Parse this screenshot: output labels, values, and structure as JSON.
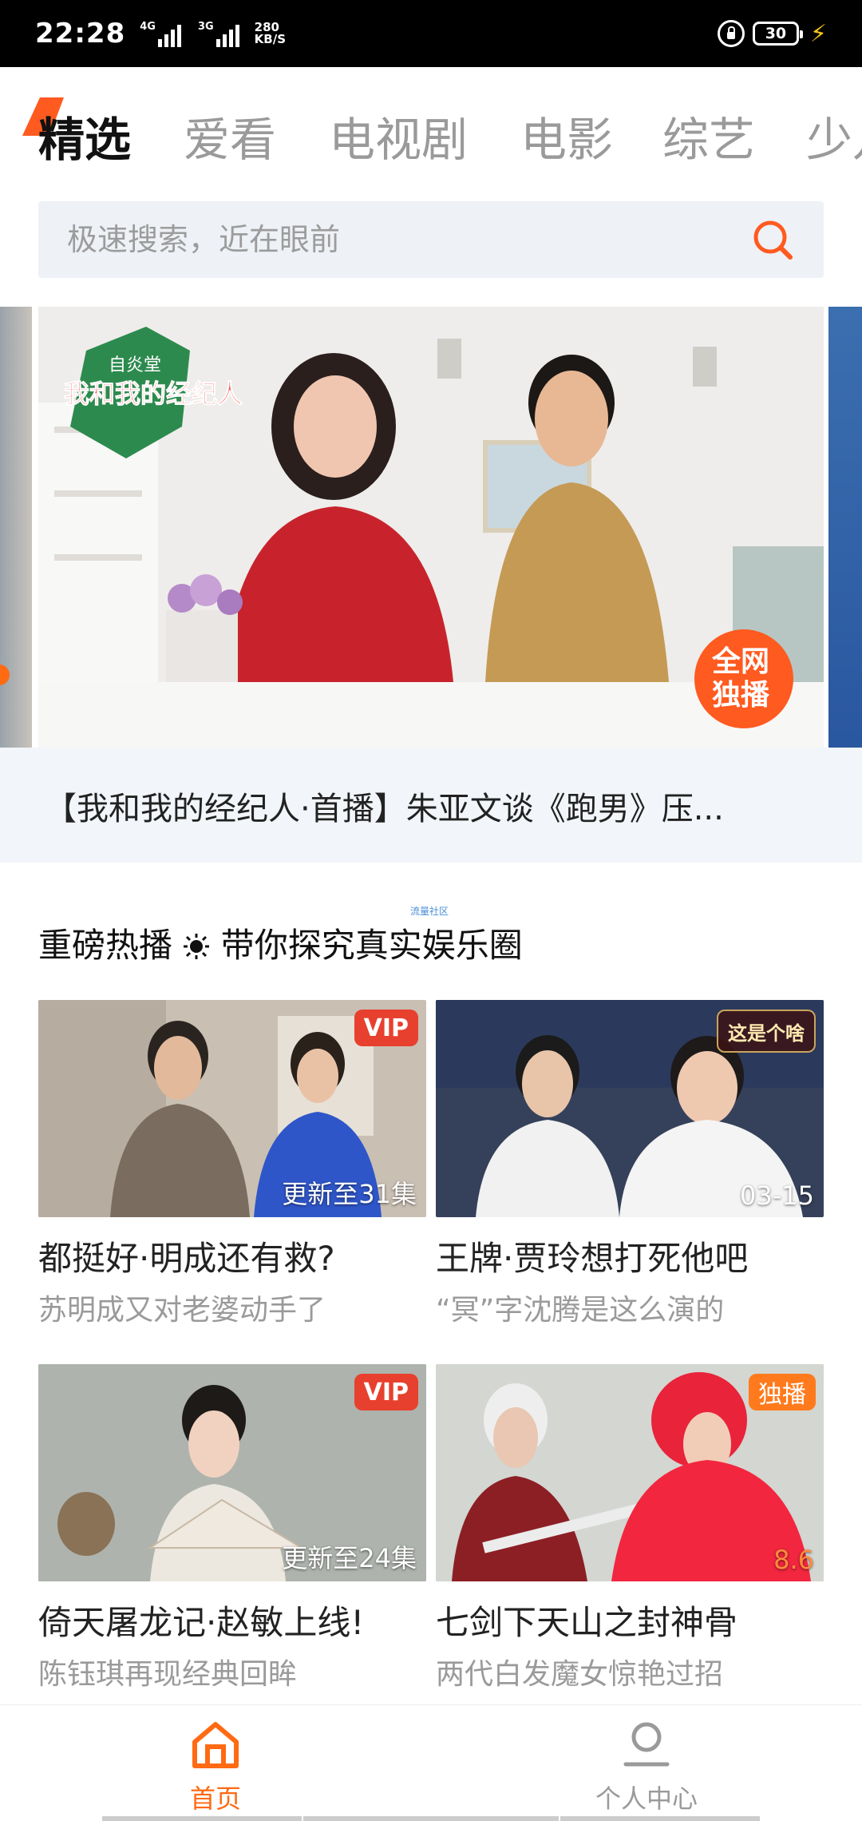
{
  "status_bar": {
    "time": "22:28",
    "signal1_label": "4G",
    "signal2_label": "3G",
    "net_speed_value": "280",
    "net_speed_unit": "KB/S",
    "battery": "30"
  },
  "tabs": [
    {
      "label": "精选",
      "active": true
    },
    {
      "label": "爱看",
      "active": false
    },
    {
      "label": "电视剧",
      "active": false
    },
    {
      "label": "电影",
      "active": false
    },
    {
      "label": "综艺",
      "active": false
    },
    {
      "label": "少儿",
      "active": false
    }
  ],
  "search": {
    "placeholder": "极速搜索，近在眼前"
  },
  "banner": {
    "show_logo_top": "自炎堂",
    "show_logo_main": "我和我的经纪人",
    "badge_line1": "全网",
    "badge_line2": "独播",
    "caption": "【我和我的经纪人·首播】朱亚文谈《跑男》压..."
  },
  "section": {
    "tag": "流量社区",
    "title_part1": "重磅热播",
    "title_part2": "带你探究真实娱乐圈"
  },
  "cards": [
    {
      "title": "都挺好·明成还有救?",
      "subtitle": "苏明成又对老婆动手了",
      "badge": "VIP",
      "corner": "更新至31集"
    },
    {
      "title": "王牌·贾玲想打死他吧",
      "subtitle": "“冥”字沈腾是这么演的",
      "badge": "这是个啥",
      "corner": "03-15"
    },
    {
      "title": "倚天屠龙记·赵敏上线!",
      "subtitle": "陈钰琪再现经典回眸",
      "badge": "VIP",
      "corner": "更新至24集"
    },
    {
      "title": "七剑下天山之封神骨",
      "subtitle": "两代白发魔女惊艳过招",
      "badge": "独播",
      "corner": "8.6"
    }
  ],
  "bottom_nav": {
    "home_label": "首页",
    "me_label": "个人中心"
  },
  "colors": {
    "accent": "#ff6a13",
    "vip_red": "#e8402e",
    "search_bg": "#eef1f6"
  }
}
